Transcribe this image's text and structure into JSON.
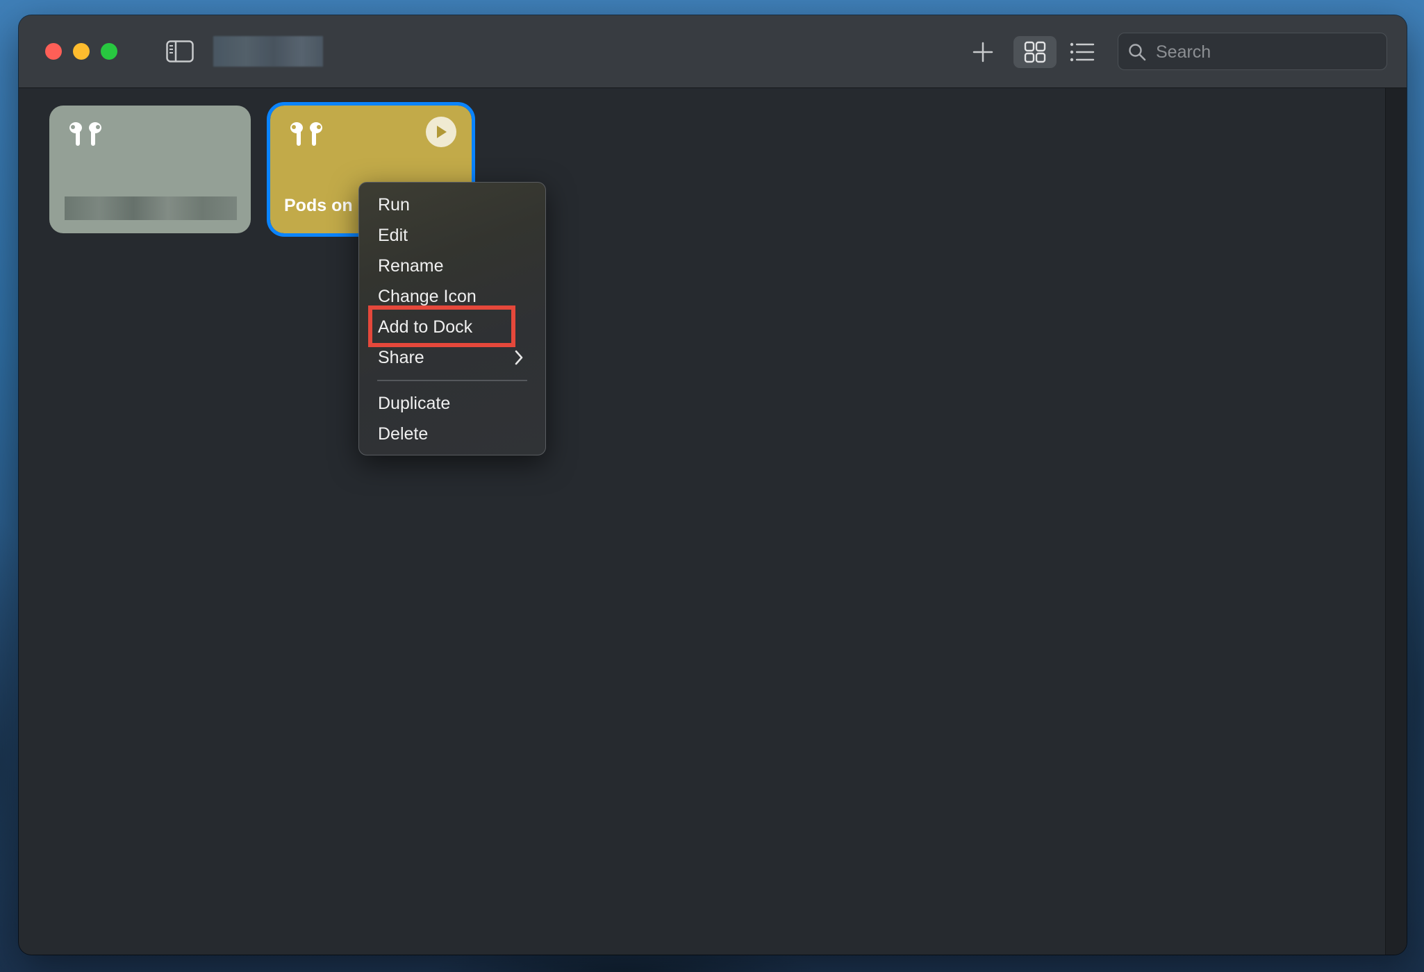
{
  "window": {
    "title_redacted": "",
    "accent_color": "#0a84ff"
  },
  "toolbar": {
    "sidebar_toggle_icon": "sidebar-icon",
    "add_icon": "plus-icon",
    "grid_view_icon": "grid-icon",
    "list_view_icon": "list-icon",
    "search_placeholder": "Search",
    "search_value": ""
  },
  "shortcuts": [
    {
      "name_redacted": "",
      "icon": "airpods-icon",
      "color": "#94a096",
      "selected": false
    },
    {
      "name": "Pods on",
      "icon": "airpods-icon",
      "color": "#c2aa49",
      "selected": true,
      "run_icon": "play-icon"
    }
  ],
  "context_menu": {
    "items": [
      {
        "label": "Run"
      },
      {
        "label": "Edit"
      },
      {
        "label": "Rename"
      },
      {
        "label": "Change Icon"
      },
      {
        "label": "Add to Dock",
        "highlighted": true
      },
      {
        "label": "Share",
        "submenu": true
      },
      {
        "label": "Duplicate"
      },
      {
        "label": "Delete"
      }
    ],
    "highlight_color": "#e5483b"
  }
}
